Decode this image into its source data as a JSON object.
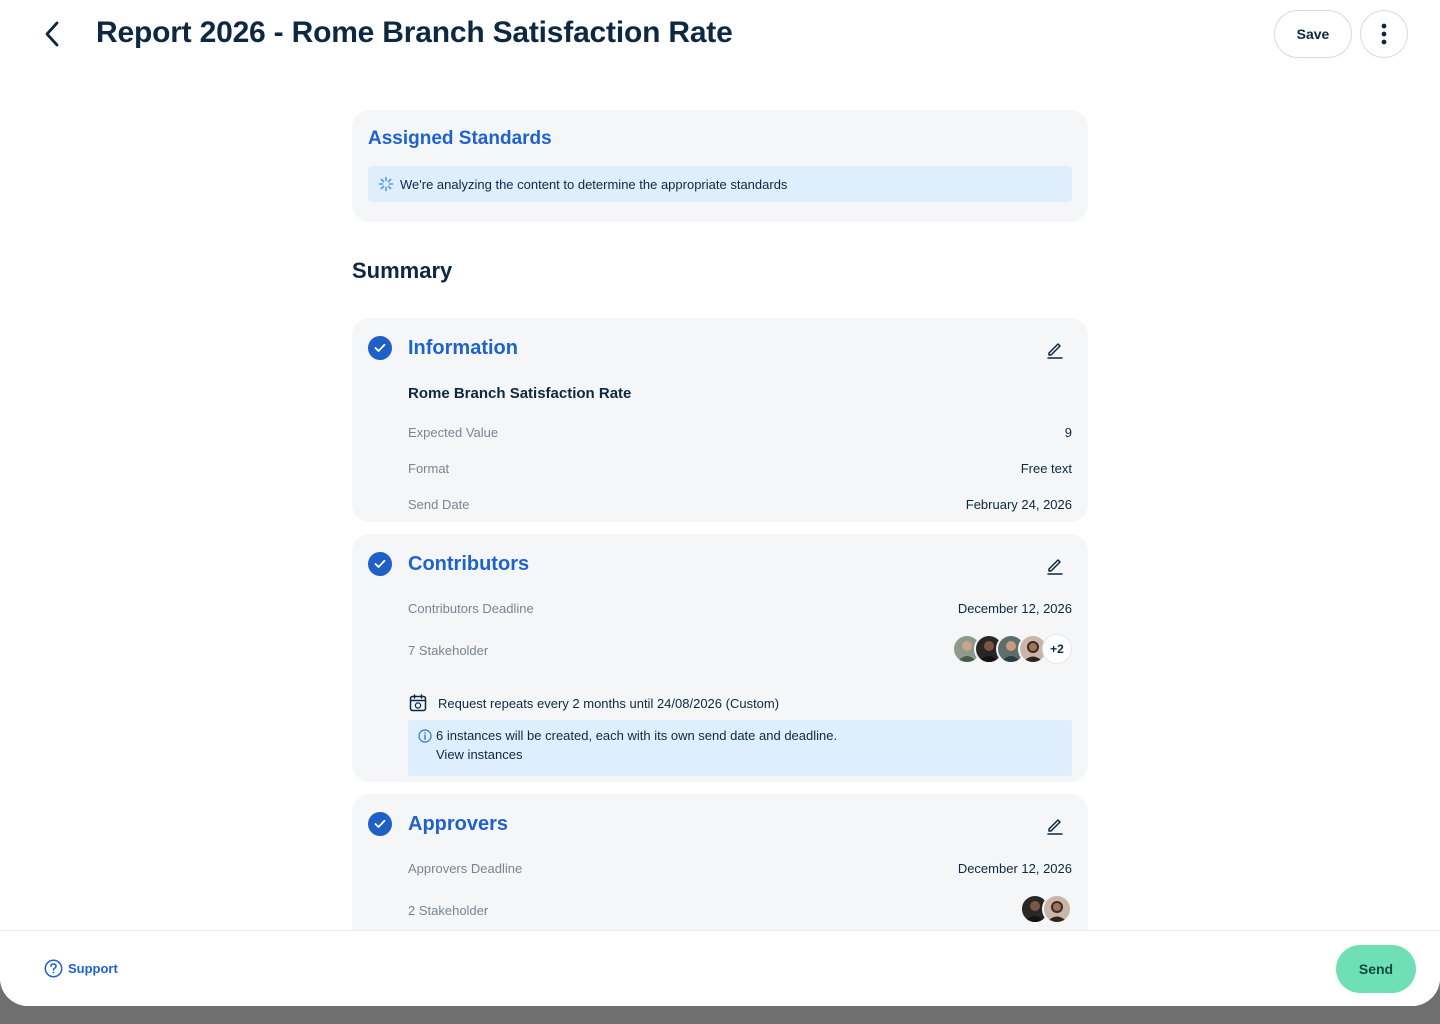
{
  "header": {
    "title": "Report 2026 - Rome Branch Satisfaction Rate",
    "save_label": "Save"
  },
  "assigned": {
    "title": "Assigned Standards",
    "status": "We're analyzing the content to determine the appropriate standards"
  },
  "summary": {
    "title": "Summary",
    "information": {
      "title": "Information",
      "name": "Rome Branch Satisfaction Rate",
      "rows": [
        {
          "label": "Expected Value",
          "value": "9"
        },
        {
          "label": "Format",
          "value": "Free text"
        },
        {
          "label": "Send Date",
          "value": "February 24, 2026"
        }
      ]
    },
    "contributors": {
      "title": "Contributors",
      "deadline_label": "Contributors Deadline",
      "deadline_value": "December 12, 2026",
      "stakeholder_label": "7 Stakeholder",
      "more_count": "+2",
      "repeat_text": "Request repeats every 2 months until 24/08/2026 (Custom)",
      "info_text": "6 instances will be created, each with its own send date and deadline.",
      "view_link": "View instances"
    },
    "approvers": {
      "title": "Approvers",
      "deadline_label": "Approvers Deadline",
      "deadline_value": "December 12, 2026",
      "stakeholder_label": "2 Stakeholder"
    }
  },
  "footer": {
    "support_label": "Support",
    "send_label": "Send"
  },
  "colors": {
    "accent": "#1f62cf",
    "send": "#6fe0b6",
    "banner": "#dfeefc",
    "card": "#f4f6f8"
  }
}
